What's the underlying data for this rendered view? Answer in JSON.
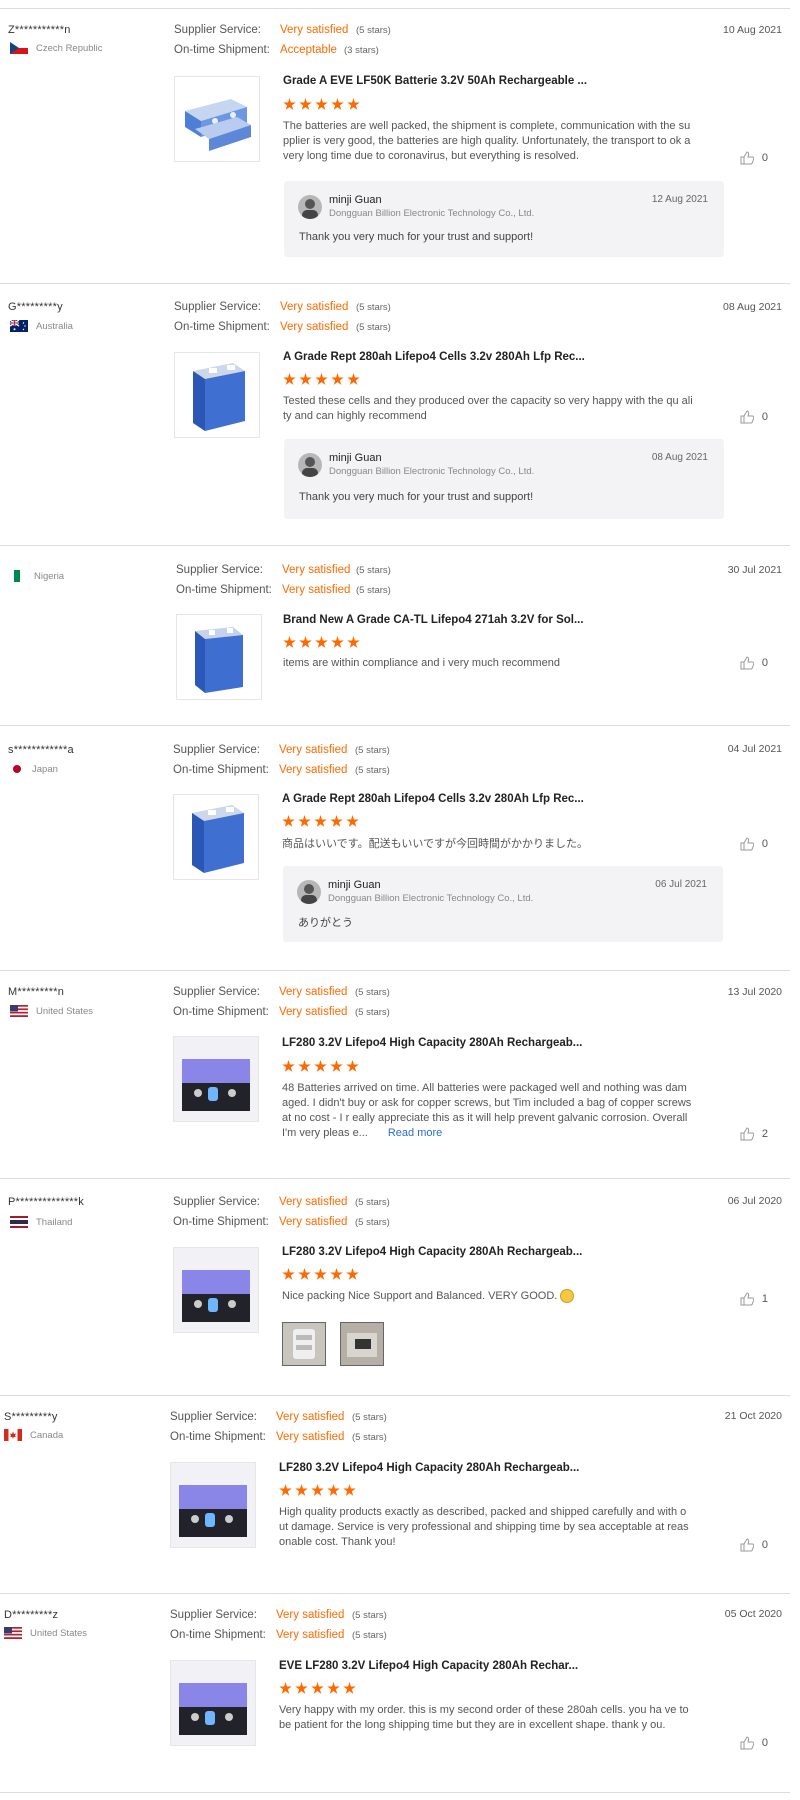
{
  "labels": {
    "supplier_service": "Supplier Service:",
    "ontime_shipment": "On-time Shipment:",
    "read_more": "Read more"
  },
  "colors": {
    "accent": "#ff6a00",
    "link": "#2b6fcb",
    "reply_bg": "#f3f3f5"
  },
  "reviews": [
    {
      "buyer": "Z***********n",
      "country": "Czech Republic",
      "flag": "czech-flag",
      "service_value": "Very satisfied",
      "service_stars": "(5 stars)",
      "shipment_value": "Acceptable",
      "shipment_stars": "(3 stars)",
      "date": "10 Aug 2021",
      "product_title": "Grade A EVE LF50K Batterie 3.2V 50Ah Rechargeable ...",
      "rating": 5,
      "text": "The batteries are well packed, the shipment is complete, communication with the supplier is very good, the batteries are high quality. Unfortunately, the transport to ok a very long time due to coronavirus, but everything is resolved.",
      "likes": "0",
      "reply": {
        "name": "minji Guan",
        "company": "Dongguan Billion Electronic Technology Co., Ltd.",
        "date": "12 Aug 2021",
        "message": "Thank you very much for your trust and support!"
      }
    },
    {
      "buyer": "G*********y",
      "country": "Australia",
      "flag": "australia-flag",
      "service_value": "Very satisfied",
      "service_stars": "(5 stars)",
      "shipment_value": "Very satisfied",
      "shipment_stars": "(5 stars)",
      "date": "08 Aug 2021",
      "product_title": "A Grade Rept 280ah Lifepo4 Cells 3.2v 280Ah Lfp Rec...",
      "rating": 5,
      "text": "Tested these cells and they produced over the capacity so very happy with the qu ality and can highly recommend",
      "likes": "0",
      "reply": {
        "name": "minji Guan",
        "company": "Dongguan Billion Electronic Technology Co., Ltd.",
        "date": "08 Aug 2021",
        "message": "Thank you very much for your trust and support!"
      }
    },
    {
      "buyer": "",
      "country": "Nigeria",
      "flag": "nigeria-flag",
      "service_value": "Very satisfied",
      "service_stars": "(5 stars)",
      "shipment_value": "Very satisfied",
      "shipment_stars": "(5 stars)",
      "date": "30 Jul 2021",
      "product_title": "Brand New A Grade CA-TL Lifepo4 271ah 3.2V for Sol...",
      "rating": 5,
      "text": "items are within compliance and i very much recommend",
      "likes": "0"
    },
    {
      "buyer": "s************a",
      "country": "Japan",
      "flag": "japan-flag",
      "service_value": "Very satisfied",
      "service_stars": "(5 stars)",
      "shipment_value": "Very satisfied",
      "shipment_stars": "(5 stars)",
      "date": "04 Jul 2021",
      "product_title": "A Grade Rept 280ah Lifepo4 Cells 3.2v 280Ah Lfp Rec...",
      "rating": 5,
      "text": "商品はいいです。配送もいいですが今回時間がかかりました。",
      "likes": "0",
      "reply": {
        "name": "minji Guan",
        "company": "Dongguan Billion Electronic Technology Co., Ltd.",
        "date": "06 Jul 2021",
        "message": "ありがとう"
      }
    },
    {
      "buyer": "M*********n",
      "country": "United States",
      "flag": "usa-flag",
      "service_value": "Very satisfied",
      "service_stars": "(5 stars)",
      "shipment_value": "Very satisfied",
      "shipment_stars": "(5 stars)",
      "date": "13 Jul 2020",
      "product_title": "LF280 3.2V Lifepo4 High Capacity 280Ah Rechargeab...",
      "rating": 5,
      "text": "48 Batteries arrived on time. All batteries were packaged well and nothing was damaged. I didn't buy or ask for copper screws, but Tim included a bag of copper screws at no cost - I r eally appreciate this as it will help prevent galvanic corrosion. Overall I'm very pleas e...",
      "likes": "2"
    },
    {
      "buyer": "P**************k",
      "country": "Thailand",
      "flag": "thailand-flag",
      "service_value": "Very satisfied",
      "service_stars": "(5 stars)",
      "shipment_value": "Very satisfied",
      "shipment_stars": "(5 stars)",
      "date": "06 Jul 2020",
      "product_title": "LF280 3.2V Lifepo4 High Capacity 280Ah Rechargeab...",
      "rating": 5,
      "text": "Nice packing Nice Support and Balanced. VERY GOOD.",
      "likes": "1"
    },
    {
      "buyer": "S*********y",
      "country": "Canada",
      "flag": "canada-flag",
      "service_value": "Very satisfied",
      "service_stars": "(5 stars)",
      "shipment_value": "Very satisfied",
      "shipment_stars": "(5 stars)",
      "date": "21 Oct 2020",
      "product_title": "LF280 3.2V Lifepo4 High Capacity 280Ah Rechargeab...",
      "rating": 5,
      "text": "High quality products exactly as described, packed and shipped carefully and with out damage.  Service is very professional and shipping time by sea acceptable at reasonable cost.  Thank you!",
      "likes": "0"
    },
    {
      "buyer": "D*********z",
      "country": "United States",
      "flag": "usa-flag",
      "service_value": "Very satisfied",
      "service_stars": "(5 stars)",
      "shipment_value": "Very satisfied",
      "shipment_stars": "(5 stars)",
      "date": "05 Oct 2020",
      "product_title": "EVE LF280 3.2V Lifepo4 High Capacity 280Ah Rechar...",
      "rating": 5,
      "text": "Very happy with my order.    this is my second order of these 280ah cells.   you ha ve to be patient for the long shipping time but they are in excellent shape.  thank y ou.",
      "likes": "0"
    }
  ]
}
